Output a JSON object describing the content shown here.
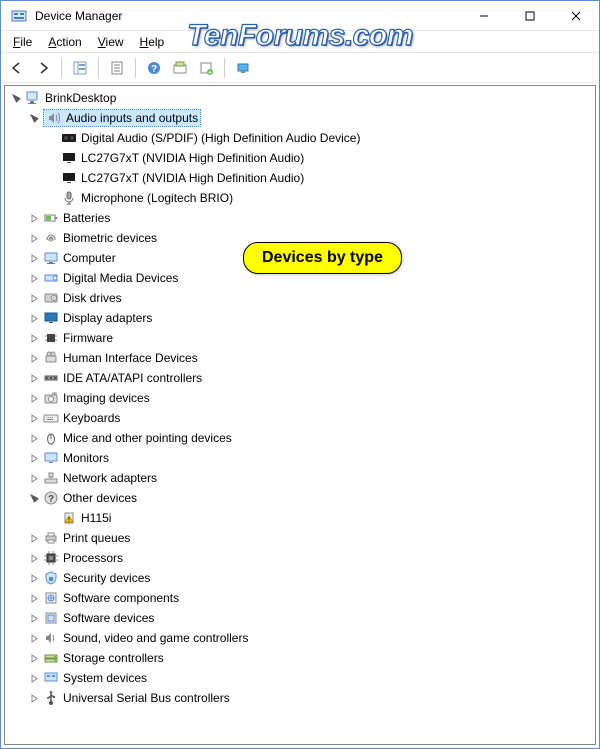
{
  "window": {
    "title": "Device Manager"
  },
  "menu": {
    "file": "File",
    "action": "Action",
    "view": "View",
    "help": "Help"
  },
  "watermark": "TenForums.com",
  "callout": "Devices by type",
  "tree": {
    "root": {
      "label": "BrinkDesktop",
      "expanded": true
    },
    "categories": [
      {
        "label": "Audio inputs and outputs",
        "icon": "speaker",
        "expanded": true,
        "selected": true,
        "children": [
          {
            "label": "Digital Audio (S/PDIF) (High Definition Audio Device)",
            "icon": "audio-out"
          },
          {
            "label": "LC27G7xT (NVIDIA High Definition Audio)",
            "icon": "monitor-small"
          },
          {
            "label": "LC27G7xT (NVIDIA High Definition Audio)",
            "icon": "monitor-small"
          },
          {
            "label": "Microphone (Logitech BRIO)",
            "icon": "mic"
          }
        ]
      },
      {
        "label": "Batteries",
        "icon": "battery"
      },
      {
        "label": "Biometric devices",
        "icon": "fingerprint"
      },
      {
        "label": "Computer",
        "icon": "computer"
      },
      {
        "label": "Digital Media Devices",
        "icon": "media"
      },
      {
        "label": "Disk drives",
        "icon": "disk"
      },
      {
        "label": "Display adapters",
        "icon": "display"
      },
      {
        "label": "Firmware",
        "icon": "chip"
      },
      {
        "label": "Human Interface Devices",
        "icon": "hid"
      },
      {
        "label": "IDE ATA/ATAPI controllers",
        "icon": "ide"
      },
      {
        "label": "Imaging devices",
        "icon": "camera"
      },
      {
        "label": "Keyboards",
        "icon": "keyboard"
      },
      {
        "label": "Mice and other pointing devices",
        "icon": "mouse"
      },
      {
        "label": "Monitors",
        "icon": "monitor"
      },
      {
        "label": "Network adapters",
        "icon": "network"
      },
      {
        "label": "Other devices",
        "icon": "unknown",
        "expanded": true,
        "children": [
          {
            "label": "H115i",
            "icon": "warning"
          }
        ]
      },
      {
        "label": "Print queues",
        "icon": "printer"
      },
      {
        "label": "Processors",
        "icon": "cpu"
      },
      {
        "label": "Security devices",
        "icon": "security"
      },
      {
        "label": "Software components",
        "icon": "softcomp"
      },
      {
        "label": "Software devices",
        "icon": "softdev"
      },
      {
        "label": "Sound, video and game controllers",
        "icon": "sound"
      },
      {
        "label": "Storage controllers",
        "icon": "storage"
      },
      {
        "label": "System devices",
        "icon": "system"
      },
      {
        "label": "Universal Serial Bus controllers",
        "icon": "usb"
      }
    ]
  }
}
